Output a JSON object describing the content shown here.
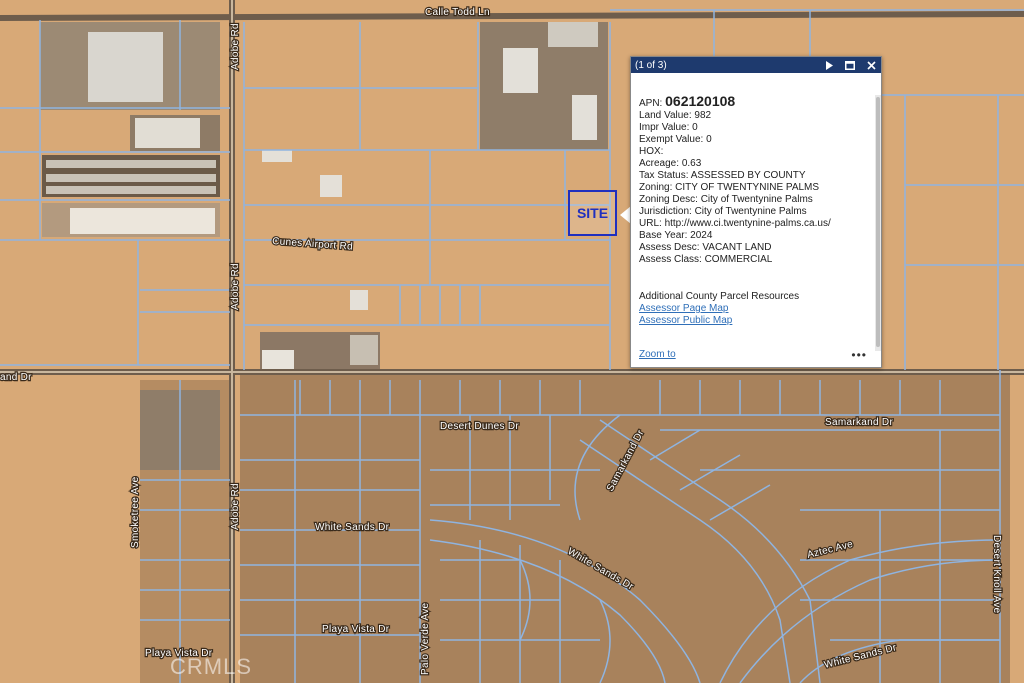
{
  "streets": {
    "calle_todd": "Calle Todd Ln",
    "adobe_top": "Adobe Rd",
    "adobe_mid": "Adobe Rd",
    "adobe_bottom": "Adobe Rd",
    "cunes_airport": "Cunes Airport Rd",
    "and_dr": "and Dr",
    "desert_dunes": "Desert Dunes Dr",
    "samarkand_diag": "Samarkand Dr",
    "samarkand_right": "Samarkand Dr",
    "white_sands_left": "White Sands Dr",
    "white_sands_curve": "White Sands Dr",
    "white_sands_bottom": "White Sands Dr",
    "aztec": "Aztec Ave",
    "smoketree": "Smoketree Ave",
    "palo_verde": "Palo Verde Ave",
    "playa_vista_mid": "Playa Vista Dr",
    "playa_vista_left": "Playa Vista Dr",
    "desert_knoll": "Desert Knoll Ave"
  },
  "site": {
    "label": "SITE"
  },
  "popup": {
    "counter": "(1 of 3)",
    "next_icon": "play-next-icon",
    "maximize_icon": "maximize-icon",
    "close_icon": "close-icon",
    "fields": [
      {
        "label": "APN: ",
        "value": "062120108"
      },
      {
        "label": "Land Value: ",
        "value": "982"
      },
      {
        "label": "Impr Value: ",
        "value": "0"
      },
      {
        "label": "Exempt Value: ",
        "value": "0"
      },
      {
        "label": "HOX: ",
        "value": ""
      },
      {
        "label": "Acreage: ",
        "value": "0.63"
      },
      {
        "label": "Tax Status: ",
        "value": "ASSESSED BY COUNTY"
      },
      {
        "label": "Zoning: ",
        "value": "CITY OF TWENTYNINE PALMS"
      },
      {
        "label": "Zoning Desc: ",
        "value": "City of Twentynine Palms"
      },
      {
        "label": "Jurisdiction: ",
        "value": "City of Twentynine Palms"
      },
      {
        "label": "URL: ",
        "value": "http://www.ci.twentynine-palms.ca.us/"
      },
      {
        "label": "Base Year: ",
        "value": "2024"
      },
      {
        "label": "Assess Desc: ",
        "value": "VACANT LAND"
      },
      {
        "label": "Assess Class: ",
        "value": "COMMERCIAL"
      }
    ],
    "resources_title": "Additional County Parcel Resources",
    "link_assessor_page": "Assessor Page Map",
    "link_assessor_public": "Assessor Public Map",
    "zoom_to": "Zoom to",
    "more": "•••"
  },
  "watermark": "CRMLS",
  "colors": {
    "accent": "#1e3a6e",
    "site": "#1f2fbf",
    "parcel_line": "#8fb4e0",
    "link": "#2f6fb8"
  }
}
